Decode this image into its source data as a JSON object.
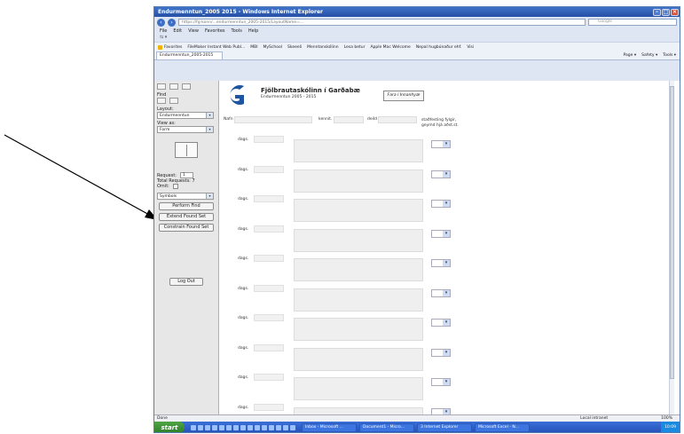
{
  "window": {
    "title": "Endurmenntun_2005 2015 - Windows Internet Explorer",
    "address": "https://fg-konn/...endurmenntun_2005-2015/LayoutName=...",
    "address_host": "fg-konn",
    "search_placeholder": "Google"
  },
  "menu": [
    "File",
    "Edit",
    "View",
    "Favorites",
    "Tools",
    "Help"
  ],
  "favorites_bar": {
    "label": "Favorites",
    "items": [
      "FileMaker Instant Web Publ...",
      "MBI",
      "MySchool",
      "Skeeeli",
      "Menntanskólinn",
      "Lesa betur",
      "Apple Mac Welcome",
      "Nepal hugbúnaður ehf.",
      "Visi"
    ]
  },
  "tab": {
    "label": "Endurmenntun_2005-2015",
    "tools": [
      "Page ▾",
      "Safety ▾",
      "Tools ▾"
    ]
  },
  "fm_panel": {
    "mode": "Find",
    "layout_label": "Layout:",
    "layout_value": "Endurmenntun",
    "view_label": "View as:",
    "view_value": "Form",
    "request_label": "Request:",
    "request_value": "1",
    "total_label": "Total Requests: 7",
    "omit_label": "Omit:",
    "symbols_value": "Symbols",
    "buttons": [
      "Perform Find",
      "Extend Found Set",
      "Constrain Found Set"
    ],
    "logout": "Log Out"
  },
  "form": {
    "school_name": "Fjölbrautaskólinn í Garðabæ",
    "subtitle": "Endurmenntun 2005 - 2015",
    "go_button": "Fara í Innanhyæ",
    "header_fields": [
      "Nafn",
      "kennit.",
      "deild"
    ],
    "staff_label_1": "staðfesting fylgir,",
    "staff_label_2": "geymd hjá aðst.st.",
    "entry_label": "dags.",
    "entries": [
      "dags.",
      "dags.",
      "dags.",
      "dags.",
      "dags.",
      "dags.",
      "dags.",
      "dags.",
      "dags.",
      "dags."
    ]
  },
  "status": {
    "left": "Done",
    "zone": "Local intranet",
    "zoom": "100%"
  },
  "taskbar": {
    "start": "start",
    "tasks": [
      "Inbox - Microsoft ...",
      "Document1 - Micro...",
      "3 Internet Explorer",
      "Microsoft Excel - N..."
    ],
    "clock": "10:09"
  }
}
